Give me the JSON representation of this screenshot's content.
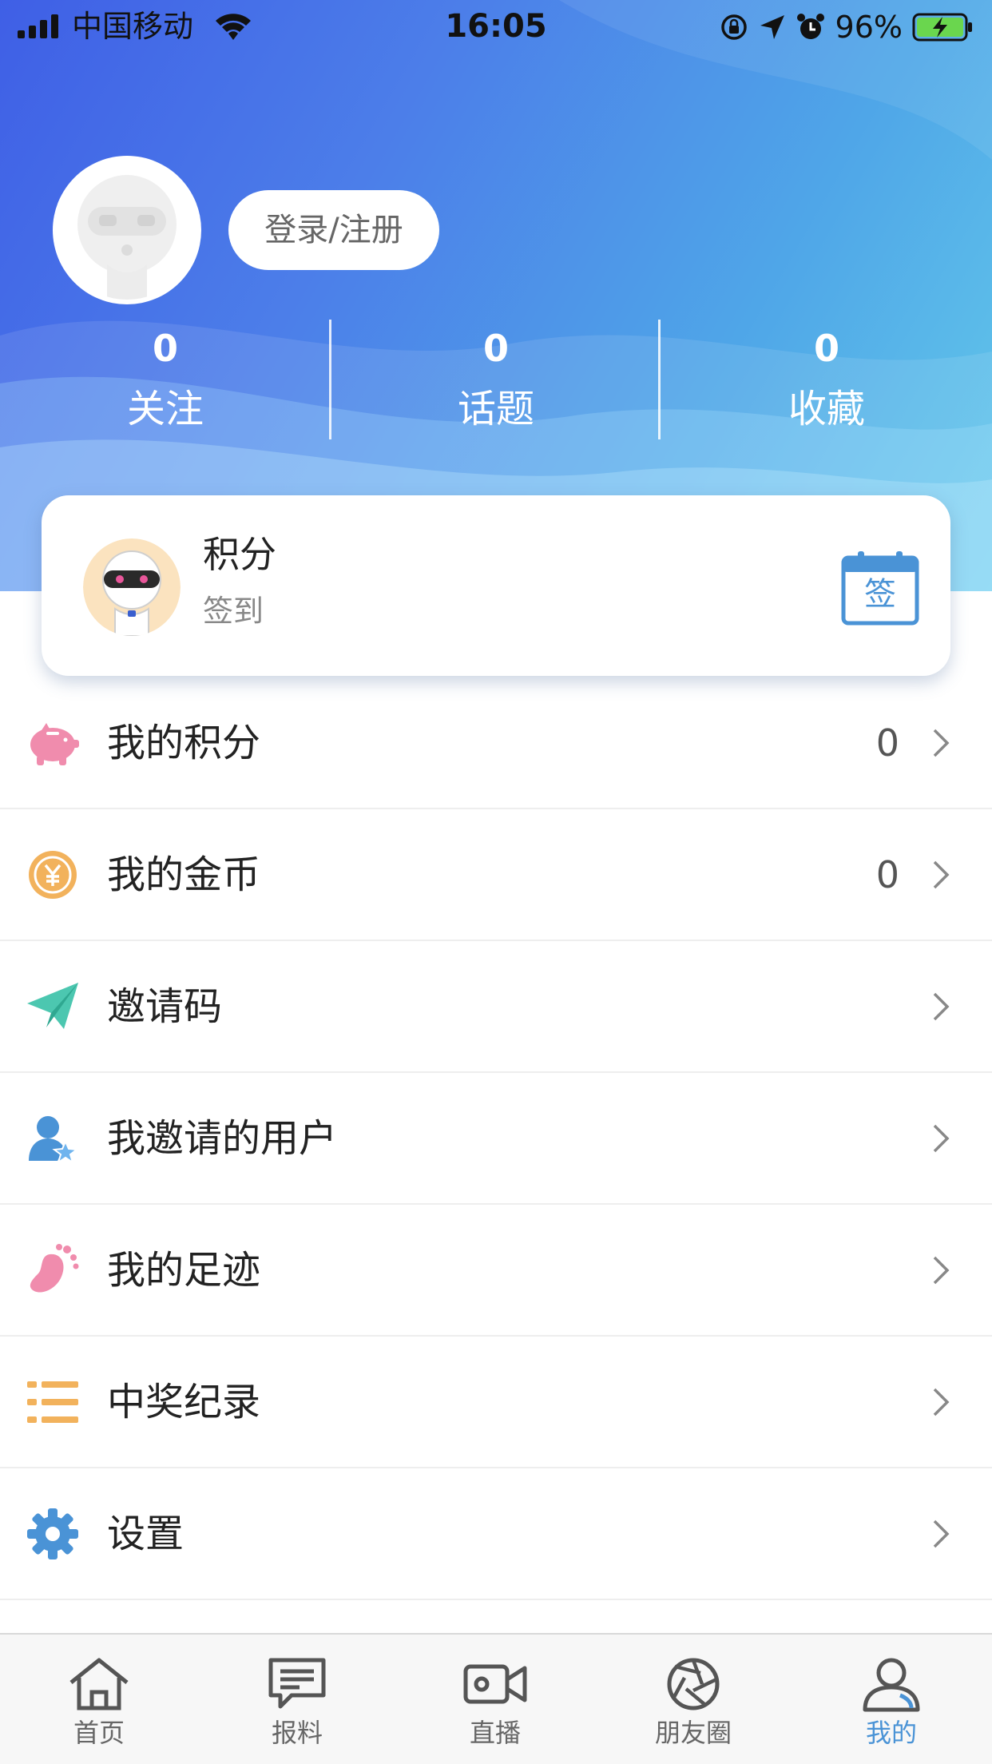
{
  "status_bar": {
    "carrier": "中国移动",
    "time": "16:05",
    "battery_percent": "96%"
  },
  "profile": {
    "login_label": "登录/注册"
  },
  "stats": [
    {
      "count": "0",
      "label": "关注"
    },
    {
      "count": "0",
      "label": "话题"
    },
    {
      "count": "0",
      "label": "收藏"
    }
  ],
  "points_card": {
    "title": "积分",
    "subtitle": "签到",
    "sign_label": "签"
  },
  "menu": [
    {
      "label": "我的积分",
      "value": "0",
      "icon": "piggy-bank-icon",
      "color": "#f08cad"
    },
    {
      "label": "我的金币",
      "value": "0",
      "icon": "coin-icon",
      "color": "#f2b25c"
    },
    {
      "label": "邀请码",
      "value": "",
      "icon": "paper-plane-icon",
      "color": "#4cc7b0"
    },
    {
      "label": "我邀请的用户",
      "value": "",
      "icon": "user-star-icon",
      "color": "#4a93d6"
    },
    {
      "label": "我的足迹",
      "value": "",
      "icon": "footprint-icon",
      "color": "#f08cad"
    },
    {
      "label": "中奖纪录",
      "value": "",
      "icon": "list-icon",
      "color": "#f2b25c"
    },
    {
      "label": "设置",
      "value": "",
      "icon": "gear-icon",
      "color": "#4a93d6"
    }
  ],
  "tabs": [
    {
      "label": "首页",
      "icon": "home-icon"
    },
    {
      "label": "报料",
      "icon": "message-icon"
    },
    {
      "label": "直播",
      "icon": "video-camera-icon"
    },
    {
      "label": "朋友圈",
      "icon": "shutter-icon"
    },
    {
      "label": "我的",
      "icon": "user-icon",
      "active": true
    }
  ],
  "colors": {
    "accent": "#4a93d6",
    "header_gradient": [
      "#3f5fe6",
      "#63c9ea"
    ]
  }
}
